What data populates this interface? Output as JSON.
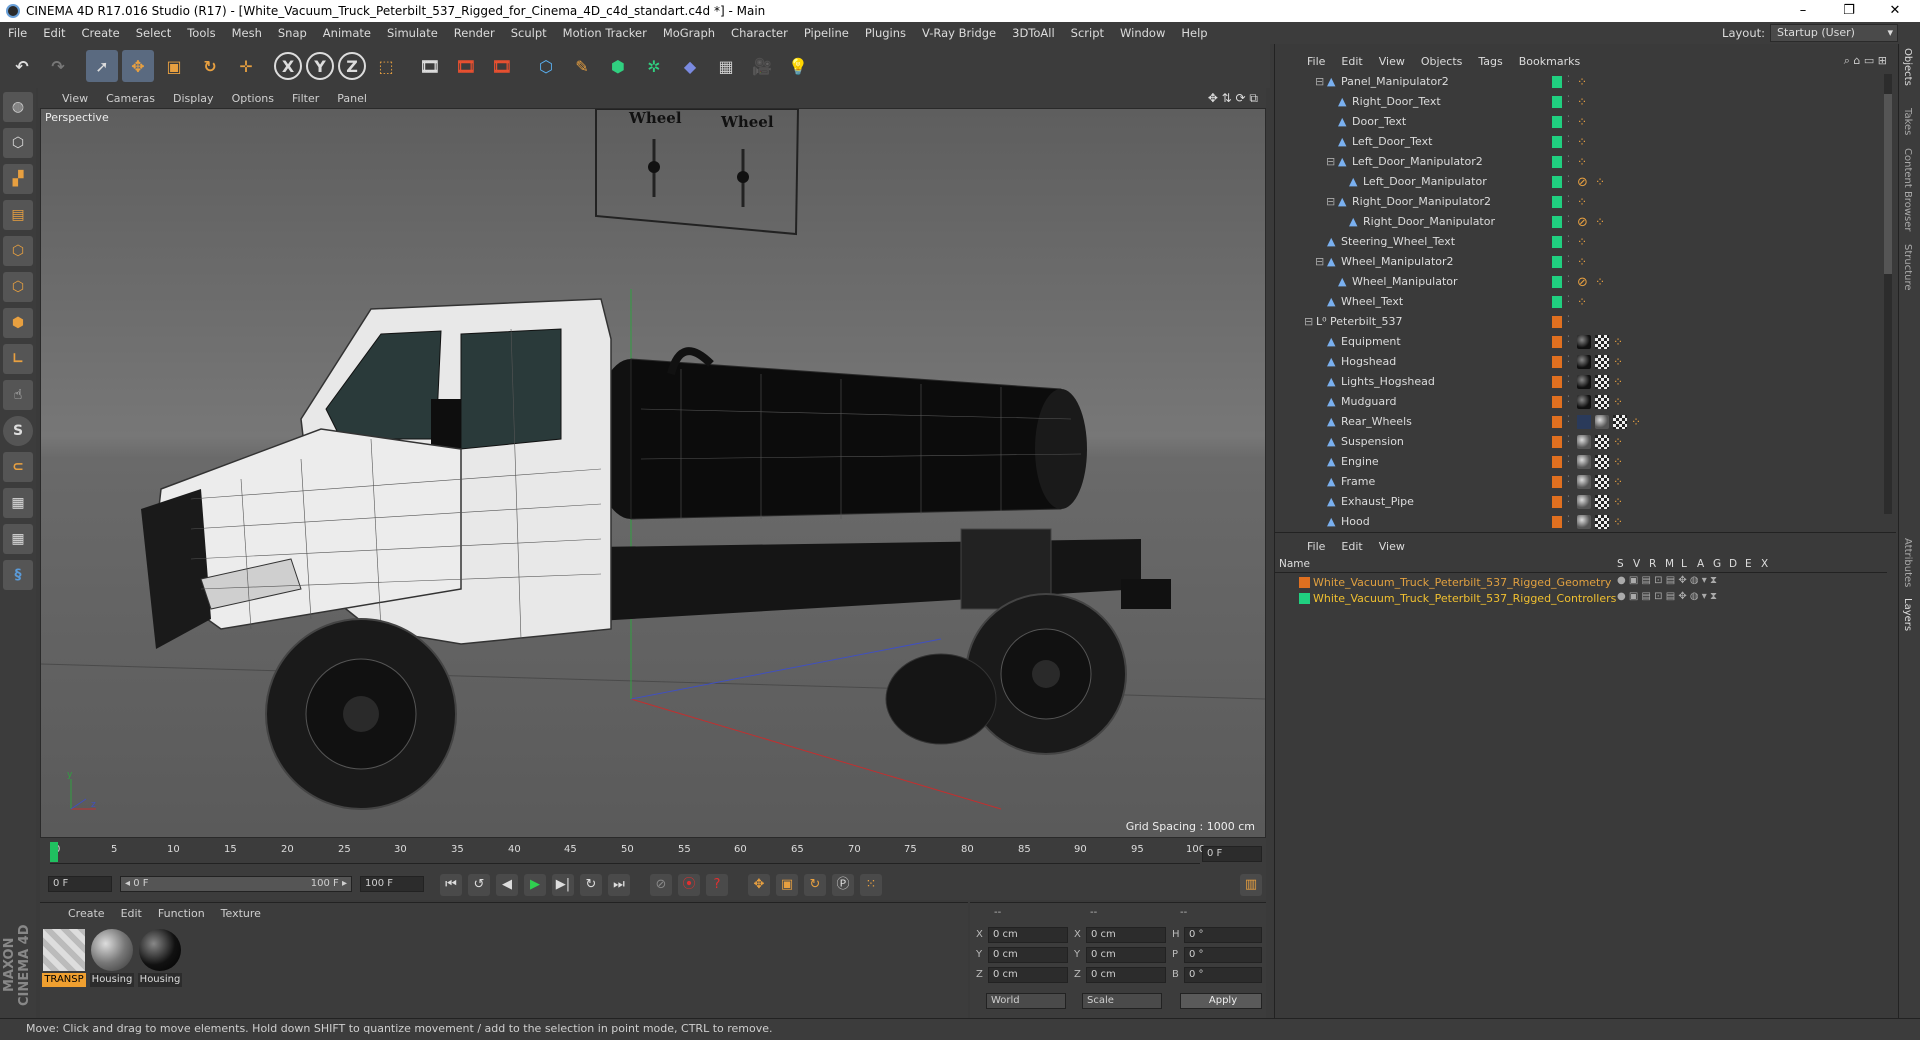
{
  "window": {
    "title": "CINEMA 4D R17.016 Studio (R17) - [White_Vacuum_Truck_Peterbilt_537_Rigged_for_Cinema_4D_c4d_standart.c4d *] - Main",
    "minimize": "–",
    "maximize": "❐",
    "close": "✕"
  },
  "menubar": [
    "File",
    "Edit",
    "Create",
    "Select",
    "Tools",
    "Mesh",
    "Snap",
    "Animate",
    "Simulate",
    "Render",
    "Sculpt",
    "Motion Tracker",
    "MoGraph",
    "Character",
    "Pipeline",
    "Plugins",
    "V-Ray Bridge",
    "3DToAll",
    "Script",
    "Window",
    "Help"
  ],
  "layout": {
    "label": "Layout:",
    "value": "Startup (User)"
  },
  "viewport": {
    "menu": [
      "View",
      "Cameras",
      "Display",
      "Options",
      "Filter",
      "Panel"
    ],
    "label": "Perspective",
    "grid_spacing": "Grid Spacing : 1000 cm",
    "sign_left": "Wheel",
    "sign_right": "Wheel"
  },
  "timeline": {
    "ticks": [
      "0",
      "5",
      "10",
      "15",
      "20",
      "25",
      "30",
      "35",
      "40",
      "45",
      "50",
      "55",
      "60",
      "65",
      "70",
      "75",
      "80",
      "85",
      "90",
      "95",
      "100"
    ],
    "frame_display": "0 F",
    "start": "0 F",
    "range_start": "◂ 0 F",
    "range_end": "100 F ▸",
    "end": "100 F"
  },
  "materials": {
    "menu": [
      "Create",
      "Edit",
      "Function",
      "Texture"
    ],
    "items": [
      {
        "label": "TRANSP",
        "color": "#d8d8d8",
        "highlight": "#f0a030"
      },
      {
        "label": "Housing",
        "color": "#8a8a8a"
      },
      {
        "label": "Housing",
        "color": "#1a1a1a"
      }
    ]
  },
  "coords": {
    "header": [
      "--",
      "--",
      "--"
    ],
    "rows": [
      {
        "a": "X",
        "av": "0 cm",
        "b": "X",
        "bv": "0 cm",
        "c": "H",
        "cv": "0 °"
      },
      {
        "a": "Y",
        "av": "0 cm",
        "b": "Y",
        "bv": "0 cm",
        "c": "P",
        "cv": "0 °"
      },
      {
        "a": "Z",
        "av": "0 cm",
        "b": "Z",
        "bv": "0 cm",
        "c": "B",
        "cv": "0 °"
      }
    ],
    "space": "World",
    "mode": "Scale",
    "apply": "Apply"
  },
  "status": "Move: Click and drag to move elements. Hold down SHIFT to quantize movement / add to the selection in point mode, CTRL to remove.",
  "object_manager": {
    "menu": [
      "File",
      "Edit",
      "View",
      "Objects",
      "Tags",
      "Bookmarks"
    ],
    "rows": [
      {
        "name": "Panel_Manipulator2",
        "indent": 4,
        "expand": "⊟",
        "vis": "#20d080",
        "tags": [
          "dots"
        ]
      },
      {
        "name": "Right_Door_Text",
        "indent": 5,
        "expand": "",
        "vis": "#20d080",
        "tags": [
          "dots"
        ]
      },
      {
        "name": "Door_Text",
        "indent": 5,
        "expand": "",
        "vis": "#20d080",
        "tags": [
          "dots"
        ]
      },
      {
        "name": "Left_Door_Text",
        "indent": 5,
        "expand": "",
        "vis": "#20d080",
        "tags": [
          "dots"
        ]
      },
      {
        "name": "Left_Door_Manipulator2",
        "indent": 5,
        "expand": "⊟",
        "vis": "#20d080",
        "tags": [
          "dots"
        ]
      },
      {
        "name": "Left_Door_Manipulator",
        "indent": 6,
        "expand": "",
        "vis": "#20d080",
        "tags": [
          "no",
          "dots"
        ]
      },
      {
        "name": "Right_Door_Manipulator2",
        "indent": 5,
        "expand": "⊟",
        "vis": "#20d080",
        "tags": [
          "dots"
        ]
      },
      {
        "name": "Right_Door_Manipulator",
        "indent": 6,
        "expand": "",
        "vis": "#20d080",
        "tags": [
          "no",
          "dots"
        ]
      },
      {
        "name": "Steering_Wheel_Text",
        "indent": 4,
        "expand": "",
        "vis": "#20d080",
        "tags": [
          "dots"
        ]
      },
      {
        "name": "Wheel_Manipulator2",
        "indent": 4,
        "expand": "⊟",
        "vis": "#20d080",
        "tags": [
          "dots"
        ]
      },
      {
        "name": "Wheel_Manipulator",
        "indent": 5,
        "expand": "",
        "vis": "#20d080",
        "tags": [
          "no",
          "dots"
        ]
      },
      {
        "name": "Wheel_Text",
        "indent": 4,
        "expand": "",
        "vis": "#20d080",
        "tags": [
          "dots"
        ]
      },
      {
        "name": "Peterbilt_537",
        "indent": 3,
        "expand": "⊟",
        "vis": "#e07020",
        "tags": []
      },
      {
        "name": "Equipment",
        "indent": 4,
        "expand": "",
        "vis": "#e07020",
        "tags": [
          "ball",
          "check",
          "dots"
        ]
      },
      {
        "name": "Hogshead",
        "indent": 4,
        "expand": "",
        "vis": "#e07020",
        "tags": [
          "ball",
          "check",
          "dots"
        ]
      },
      {
        "name": "Lights_Hogshead",
        "indent": 4,
        "expand": "",
        "vis": "#e07020",
        "tags": [
          "ball",
          "check",
          "dots"
        ]
      },
      {
        "name": "Mudguard",
        "indent": 4,
        "expand": "",
        "vis": "#e07020",
        "tags": [
          "ball",
          "check",
          "dots"
        ]
      },
      {
        "name": "Rear_Wheels",
        "indent": 4,
        "expand": "",
        "vis": "#e07020",
        "tags": [
          "tex",
          "ball2",
          "check",
          "dots"
        ]
      },
      {
        "name": "Suspension",
        "indent": 4,
        "expand": "",
        "vis": "#e07020",
        "tags": [
          "ball2",
          "check",
          "dots"
        ]
      },
      {
        "name": "Engine",
        "indent": 4,
        "expand": "",
        "vis": "#e07020",
        "tags": [
          "ball2",
          "check",
          "dots"
        ]
      },
      {
        "name": "Frame",
        "indent": 4,
        "expand": "",
        "vis": "#e07020",
        "tags": [
          "ball2",
          "check",
          "dots"
        ]
      },
      {
        "name": "Exhaust_Pipe",
        "indent": 4,
        "expand": "",
        "vis": "#e07020",
        "tags": [
          "ball2",
          "check",
          "dots"
        ]
      },
      {
        "name": "Hood",
        "indent": 4,
        "expand": "",
        "vis": "#e07020",
        "tags": [
          "ball2",
          "check",
          "dots"
        ]
      }
    ]
  },
  "layer_manager": {
    "menu": [
      "File",
      "Edit",
      "View"
    ],
    "columns": [
      "Name",
      "S",
      "V",
      "R",
      "M",
      "L",
      "A",
      "G",
      "D",
      "E",
      "X"
    ],
    "rows": [
      {
        "name": "White_Vacuum_Truck_Peterbilt_537_Rigged_Geometry",
        "color": "#e07020",
        "text_color": "#e0a040"
      },
      {
        "name": "White_Vacuum_Truck_Peterbilt_537_Rigged_Controllers",
        "color": "#20d080",
        "text_color": "#f0c030"
      }
    ]
  },
  "side_tabs": [
    "Objects",
    "Takes",
    "Content Browser",
    "Structure",
    "Attributes",
    "Layers"
  ]
}
